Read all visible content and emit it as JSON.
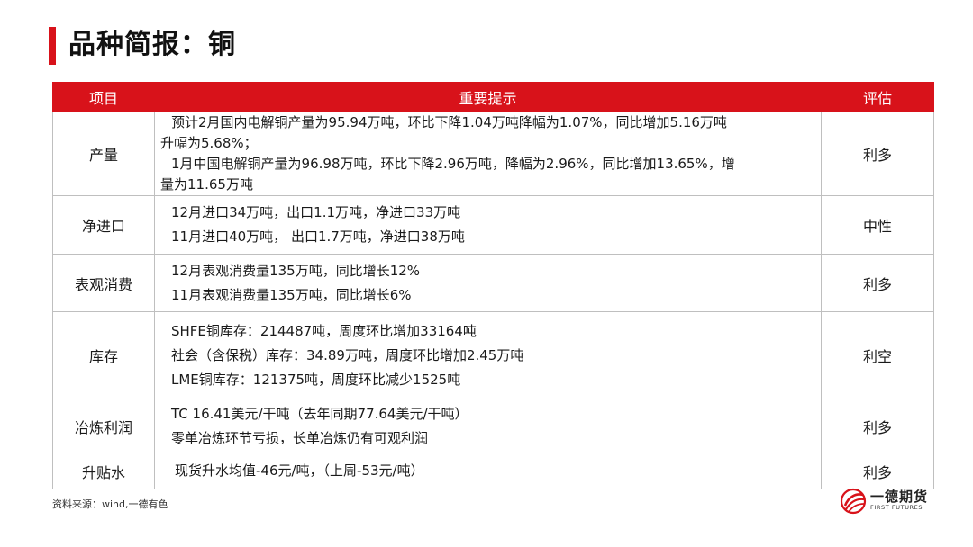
{
  "title": "品种简报：铜",
  "table": {
    "headers": [
      "项目",
      "重要提示",
      "评估"
    ],
    "rows": [
      {
        "item": "产量",
        "lines": [
          "预计2月国内电解铜产量为95.94万吨，环比下降1.04万吨降幅为1.07%，同比增加5.16万吨",
          "升幅为5.68%；",
          "1月中国电解铜产量为96.98万吨，环比下降2.96万吨，降幅为2.96%，同比增加13.65%，增",
          "量为11.65万吨"
        ],
        "eval": "利多"
      },
      {
        "item": "净进口",
        "lines": [
          "12月进口34万吨，出口1.1万吨，净进口33万吨",
          "11月进口40万吨，  出口1.7万吨，净进口38万吨"
        ],
        "eval": "中性"
      },
      {
        "item": "表观消费",
        "lines": [
          "12月表观消费量135万吨，同比增长12%",
          "11月表观消费量135万吨，同比增长6%"
        ],
        "eval": "利多"
      },
      {
        "item": "库存",
        "lines": [
          "SHFE铜库存：214487吨，周度环比增加33164吨",
          "社会（含保税）库存：34.89万吨，周度环比增加2.45万吨",
          "LME铜库存：121375吨，周度环比减少1525吨"
        ],
        "eval": "利空"
      },
      {
        "item": "冶炼利润",
        "lines": [
          "TC 16.41美元/干吨（去年同期77.64美元/干吨）",
          "零单冶炼环节亏损，长单冶炼仍有可观利润"
        ],
        "eval": "利多"
      },
      {
        "item": "升贴水",
        "lines": [
          "现货升水均值-46元/吨，（上周-53元/吨）"
        ],
        "eval": "利多"
      }
    ]
  },
  "source": "资料来源：wind,一德有色",
  "logo": {
    "name": "一德期货",
    "sub": "FIRST FUTURES",
    "icon": "first-futures-logo-icon",
    "color": "#d8121a"
  },
  "colors": {
    "accent": "#d8121a",
    "border": "#bfbfbf"
  }
}
